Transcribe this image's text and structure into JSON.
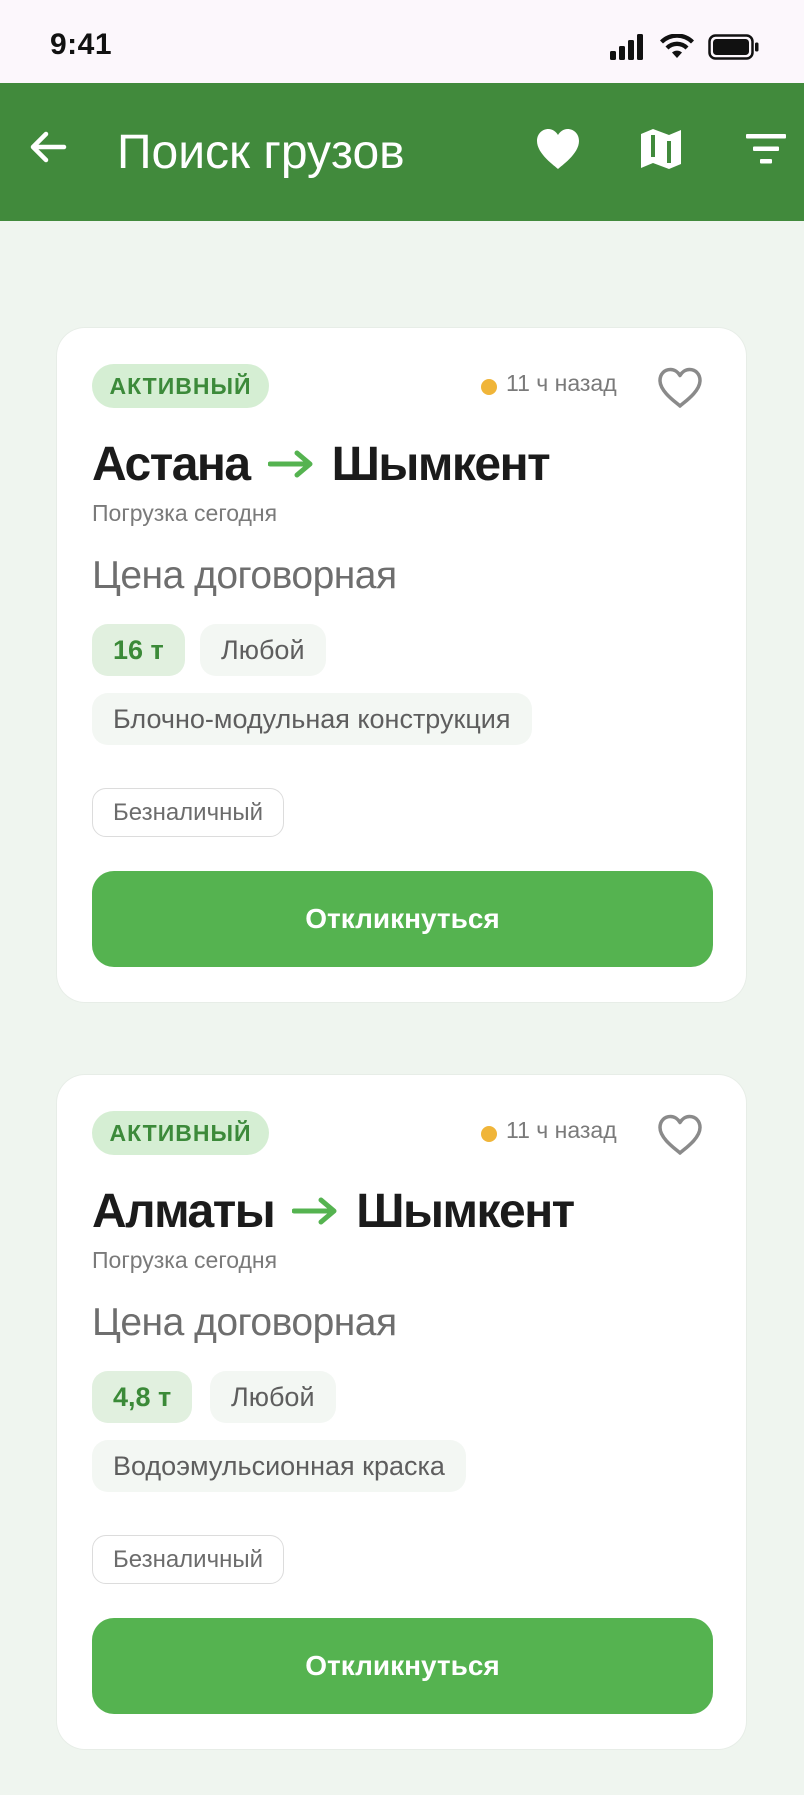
{
  "status_bar": {
    "time": "9:41"
  },
  "app_bar": {
    "title": "Поиск грузов",
    "back_icon": "arrow-left-icon",
    "actions": [
      "heart-icon",
      "map-icon",
      "filter-icon"
    ],
    "background_color": "#418a3c"
  },
  "cards": [
    {
      "status": "АКТИВНЫЙ",
      "time_ago": "11 ч назад",
      "from": "Астана",
      "to": "Шымкент",
      "loading": "Погрузка сегодня",
      "price": "Цена договорная",
      "weight": "16 т",
      "body_type": "Любой",
      "cargo": "Блочно-модульная конструкция",
      "payment": "Безналичный",
      "button_label": "Откликнуться"
    },
    {
      "status": "АКТИВНЫЙ",
      "time_ago": "11 ч назад",
      "from": "Алматы",
      "to": "Шымкент",
      "loading": "Погрузка сегодня",
      "price": "Цена договорная",
      "weight": "4,8 т",
      "body_type": "Любой",
      "cargo": "Водоэмульсионная краска",
      "payment": "Безналичный",
      "button_label": "Откликнуться"
    }
  ],
  "colors": {
    "accent": "#55b350",
    "status_dot": "#f0b539",
    "badge_bg": "#d5eed3",
    "page_bg": "#eff5ef"
  }
}
